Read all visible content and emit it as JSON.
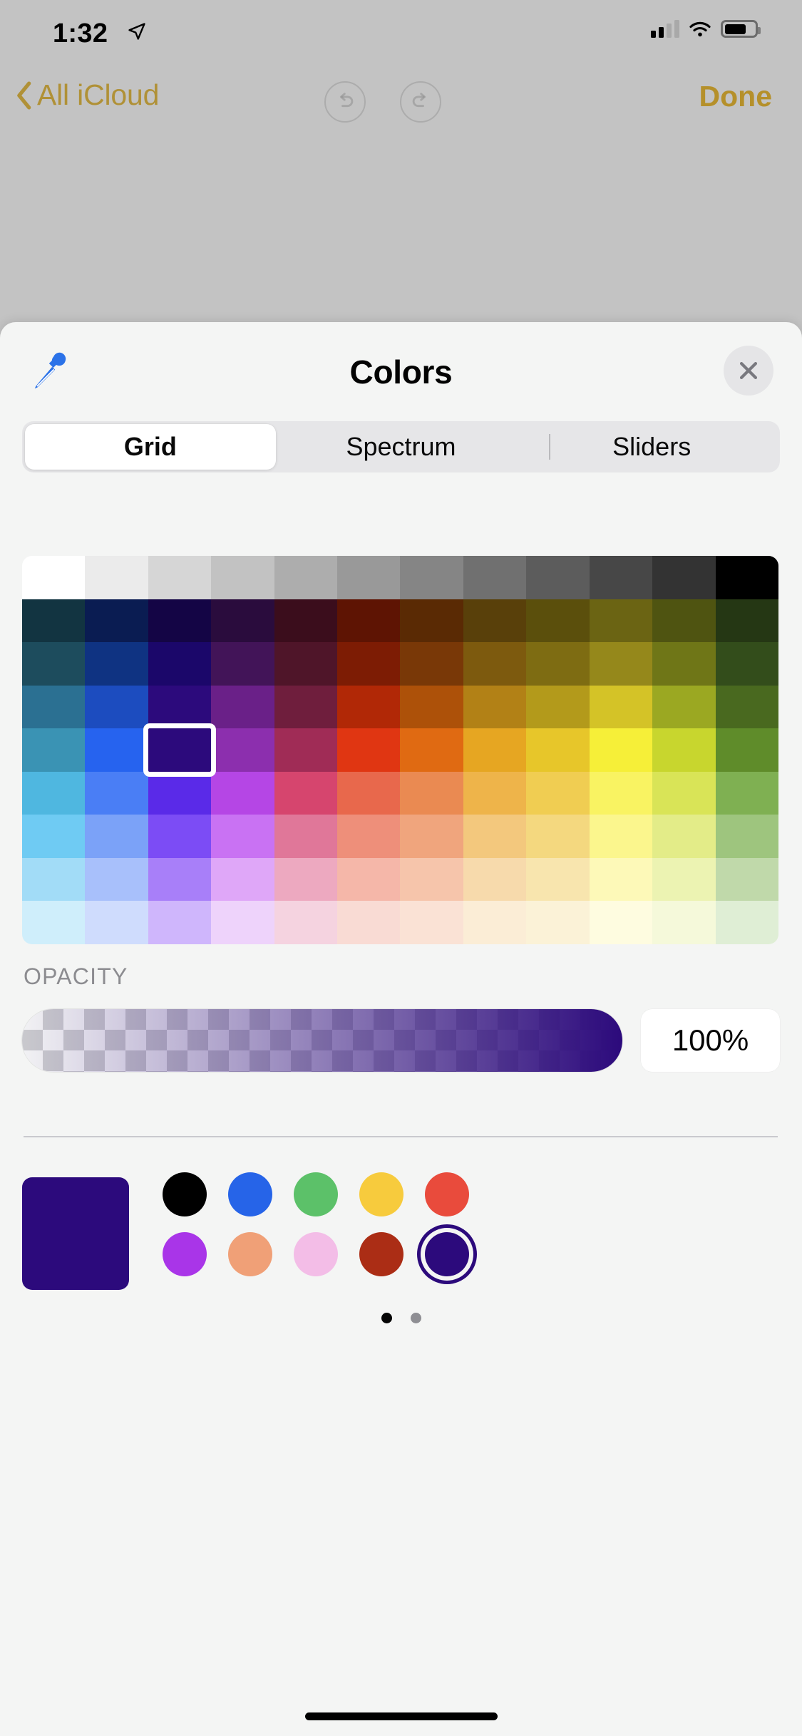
{
  "status_bar": {
    "time": "1:32",
    "location_icon": "location-arrow-icon",
    "cellular_icon": "cellular-bars-icon",
    "wifi_icon": "wifi-icon",
    "battery_icon": "battery-icon"
  },
  "nav_bar": {
    "back_label": "All iCloud",
    "back_chevron_icon": "chevron-left-icon",
    "undo_icon": "undo-icon",
    "redo_icon": "redo-icon",
    "done_label": "Done",
    "accent_color": "#b09137"
  },
  "sheet": {
    "title": "Colors",
    "eyedropper_icon": "eyedropper-icon",
    "eyedropper_color": "#2b72e8",
    "close_icon": "close-x-icon"
  },
  "tabs": {
    "items": [
      {
        "label": "Grid",
        "selected": true
      },
      {
        "label": "Spectrum",
        "selected": false
      },
      {
        "label": "Sliders",
        "selected": false
      }
    ]
  },
  "grid": {
    "columns": 12,
    "selected_row": 4,
    "selected_col": 2,
    "selected_color": "#2c0a7c",
    "rows": [
      [
        "#ffffff",
        "#ebebeb",
        "#d6d6d6",
        "#c2c2c2",
        "#adadad",
        "#999999",
        "#858585",
        "#707070",
        "#5c5c5c",
        "#474747",
        "#333333",
        "#000000"
      ],
      [
        "#123441",
        "#0a1c52",
        "#140545",
        "#2a0c3d",
        "#3b0d1c",
        "#5e1403",
        "#5a2a04",
        "#59400a",
        "#5b4f0c",
        "#6b6413",
        "#4f5411",
        "#253714"
      ],
      [
        "#1d4c5d",
        "#0f3382",
        "#1b076a",
        "#421458",
        "#4f1529",
        "#7d1c04",
        "#793807",
        "#7d5a0e",
        "#7e6c12",
        "#95881b",
        "#6f7617",
        "#334d1b"
      ],
      [
        "#2b7092",
        "#1c4cbf",
        "#2c0a7c",
        "#6a2088",
        "#6f1e3d",
        "#b12806",
        "#ad5109",
        "#b28116",
        "#b39a1b",
        "#d4c327",
        "#9ba822",
        "#49691f"
      ],
      [
        "#3a93b4",
        "#2663ef",
        "#3a18b0",
        "#8c2fae",
        "#a02c56",
        "#e03612",
        "#e06a12",
        "#e6a622",
        "#e7c62a",
        "#f6ef38",
        "#c8d62e",
        "#5f8c2a"
      ],
      [
        "#4fb7e0",
        "#4a7ef5",
        "#5a2ae8",
        "#b546e5",
        "#d6456e",
        "#e8684c",
        "#ea8a52",
        "#eeb44a",
        "#f0cd52",
        "#f9f362",
        "#d9e457",
        "#7fb052"
      ],
      [
        "#6fcbf3",
        "#7ba2f8",
        "#7c4cf5",
        "#c972f3",
        "#e07799",
        "#ee8f7a",
        "#f0a57d",
        "#f3c87d",
        "#f4d87f",
        "#fbf68d",
        "#e3ec88",
        "#9ec57e"
      ],
      [
        "#a2dcf7",
        "#a8c0fb",
        "#a87ff9",
        "#dfa7f8",
        "#eda9c0",
        "#f5b7a9",
        "#f6c5ab",
        "#f7daac",
        "#f8e5ae",
        "#fdf9b8",
        "#ecf3b2",
        "#c0d9aa"
      ],
      [
        "#cfeefb",
        "#cfdcfd",
        "#cfb6fc",
        "#eed3fb",
        "#f5d3e0",
        "#f9dbd4",
        "#fae2d5",
        "#fbedd6",
        "#fbf2d7",
        "#fefce0",
        "#f5f9da",
        "#dfeed5"
      ]
    ]
  },
  "opacity": {
    "label": "OPACITY",
    "value": "100%",
    "percent": 100,
    "color": "#2c0a7c"
  },
  "palette": {
    "preview_color": "#2c0a7c",
    "rows": [
      [
        {
          "name": "black",
          "color": "#000000",
          "selected": false
        },
        {
          "name": "blue",
          "color": "#2664e8",
          "selected": false
        },
        {
          "name": "green",
          "color": "#5cc169",
          "selected": false
        },
        {
          "name": "yellow",
          "color": "#f7cb3d",
          "selected": false
        },
        {
          "name": "red",
          "color": "#e94b3c",
          "selected": false
        }
      ],
      [
        {
          "name": "purple",
          "color": "#a935e8",
          "selected": false
        },
        {
          "name": "peach",
          "color": "#f0a077",
          "selected": false
        },
        {
          "name": "pink",
          "color": "#f3bde7",
          "selected": false
        },
        {
          "name": "brick",
          "color": "#ab2d15",
          "selected": false
        },
        {
          "name": "indigo",
          "color": "#2c0a7c",
          "selected": true
        }
      ]
    ],
    "page_dots": [
      {
        "active": true
      },
      {
        "active": false
      }
    ]
  },
  "home_indicator": "home-indicator"
}
